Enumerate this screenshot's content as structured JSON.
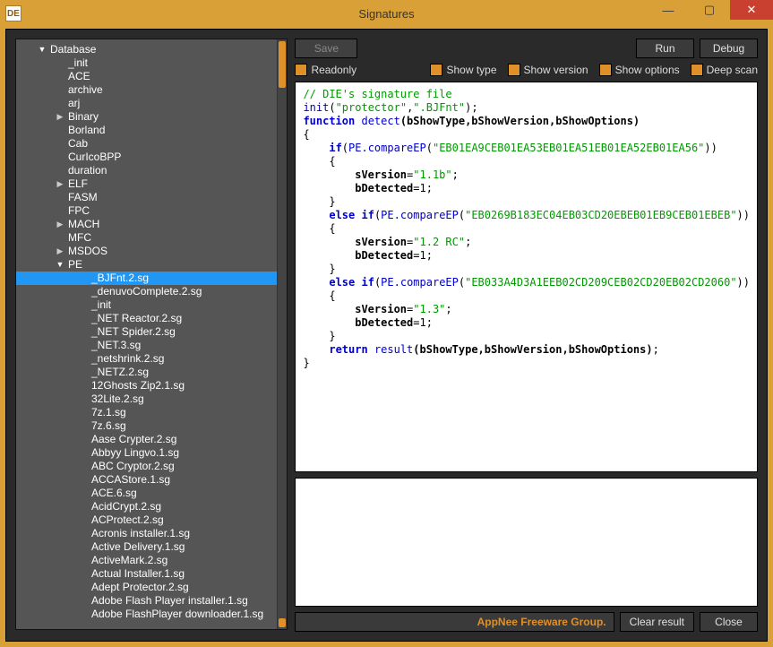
{
  "window": {
    "title": "Signatures",
    "app_icon_label": "DE"
  },
  "buttons": {
    "save": "Save",
    "run": "Run",
    "debug": "Debug",
    "clear_result": "Clear result",
    "close": "Close"
  },
  "checks": {
    "readonly": "Readonly",
    "show_type": "Show type",
    "show_version": "Show version",
    "show_options": "Show options",
    "deep_scan": "Deep scan"
  },
  "status_link": "AppNee Freeware Group.",
  "tree": {
    "root": "Database",
    "items_level1": [
      {
        "label": "_init",
        "arrow": ""
      },
      {
        "label": "ACE",
        "arrow": ""
      },
      {
        "label": "archive",
        "arrow": ""
      },
      {
        "label": "arj",
        "arrow": ""
      },
      {
        "label": "Binary",
        "arrow": "▶"
      },
      {
        "label": "Borland",
        "arrow": ""
      },
      {
        "label": "Cab",
        "arrow": ""
      },
      {
        "label": "CurIcoBPP",
        "arrow": ""
      },
      {
        "label": "duration",
        "arrow": ""
      },
      {
        "label": "ELF",
        "arrow": "▶"
      },
      {
        "label": "FASM",
        "arrow": ""
      },
      {
        "label": "FPC",
        "arrow": ""
      },
      {
        "label": "MACH",
        "arrow": "▶"
      },
      {
        "label": "MFC",
        "arrow": ""
      },
      {
        "label": "MSDOS",
        "arrow": "▶"
      },
      {
        "label": "PE",
        "arrow": "▼"
      }
    ],
    "pe_children": [
      "_BJFnt.2.sg",
      "_denuvoComplete.2.sg",
      "_init",
      "_NET Reactor.2.sg",
      "_NET Spider.2.sg",
      "_NET.3.sg",
      "_netshrink.2.sg",
      "_NETZ.2.sg",
      "12Ghosts Zip2.1.sg",
      "32Lite.2.sg",
      "7z.1.sg",
      "7z.6.sg",
      "Aase Crypter.2.sg",
      "Abbyy Lingvo.1.sg",
      "ABC Cryptor.2.sg",
      "ACCAStore.1.sg",
      "ACE.6.sg",
      "AcidCrypt.2.sg",
      "ACProtect.2.sg",
      "Acronis installer.1.sg",
      "Active Delivery.1.sg",
      "ActiveMark.2.sg",
      "Actual Installer.1.sg",
      "Adept Protector.2.sg",
      "Adobe Flash Player installer.1.sg",
      "Adobe FlashPlayer downloader.1.sg"
    ],
    "selected": "_BJFnt.2.sg"
  },
  "code": {
    "comment": "// DIE's signature file",
    "init_fn": "init",
    "init_arg1": "\"protector\"",
    "init_arg2": "\".BJFnt\"",
    "func_kw": "function",
    "detect_name": "detect",
    "detect_params": "(bShowType,bShowVersion,bShowOptions)",
    "if_kw": "if",
    "else_kw": "else",
    "pe_compare": "PE.compareEP",
    "ep1": "\"EB01EA9CEB01EA53EB01EA51EB01EA52EB01EA56\"",
    "ep2": "\"EB0269B183EC04EB03CD20EBEB01EB9CEB01EBEB\"",
    "ep3": "\"EB033A4D3A1EEB02CD209CEB02CD20EB02CD2060\"",
    "ver1": "\"1.1b\"",
    "ver2": "\"1.2 RC\"",
    "ver3": "\"1.3\"",
    "sversion": "sVersion",
    "bdetected": "bDetected",
    "one": "1",
    "return_kw": "return",
    "result_fn": "result",
    "result_args": "(bShowType,bShowVersion,bShowOptions)"
  }
}
